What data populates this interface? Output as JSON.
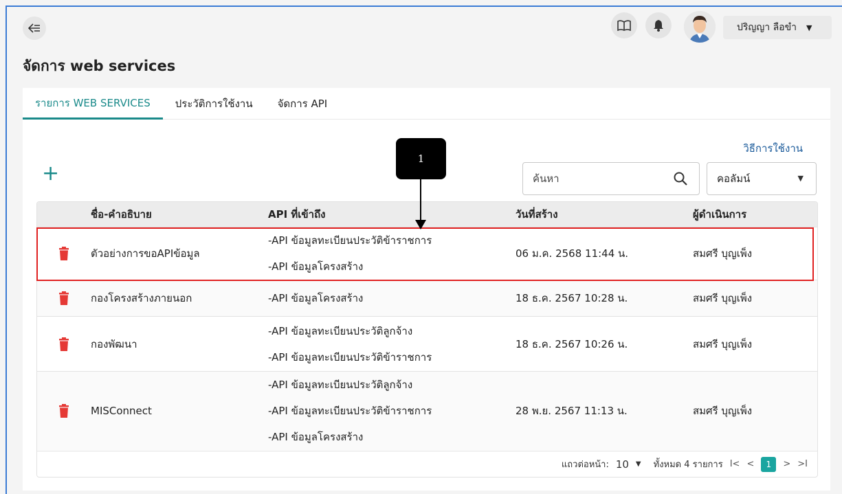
{
  "header": {
    "user_name": "ปริญญา ลือขำ"
  },
  "page": {
    "title": "จัดการ web services"
  },
  "tabs": [
    {
      "label": "รายการ WEB SERVICES"
    },
    {
      "label": "ประวัติการใช้งาน"
    },
    {
      "label": "จัดการ API"
    }
  ],
  "toolbar": {
    "help_link": "วิธีการใช้งาน",
    "add_symbol": "+",
    "search_placeholder": "ค้นหา",
    "column_select": "คอลัมน์"
  },
  "table": {
    "headers": {
      "name": "ชื่อ-คำอธิบาย",
      "api": "API ที่เข้าถึง",
      "created": "วันที่สร้าง",
      "operator": "ผู้ดำเนินการ"
    },
    "rows": [
      {
        "name": "ตัวอย่างการขอAPIข้อมูล",
        "apis": [
          "-API ข้อมูลทะเบียนประวัติข้าราชการ",
          "-API ข้อมูลโครงสร้าง"
        ],
        "created": "06 ม.ค. 2568 11:44 น.",
        "operator": "สมศรี บุญเพ็ง"
      },
      {
        "name": "กองโครงสร้างภายนอก",
        "apis": [
          "-API ข้อมูลโครงสร้าง"
        ],
        "created": "18 ธ.ค. 2567 10:28 น.",
        "operator": "สมศรี บุญเพ็ง"
      },
      {
        "name": "กองพัฒนา",
        "apis": [
          "-API ข้อมูลทะเบียนประวัติลูกจ้าง",
          "-API ข้อมูลทะเบียนประวัติข้าราชการ"
        ],
        "created": "18 ธ.ค. 2567 10:26 น.",
        "operator": "สมศรี บุญเพ็ง"
      },
      {
        "name": "MISConnect",
        "apis": [
          "-API ข้อมูลทะเบียนประวัติลูกจ้าง",
          "-API ข้อมูลทะเบียนประวัติข้าราชการ",
          "-API ข้อมูลโครงสร้าง"
        ],
        "created": "28 พ.ย. 2567 11:13 น.",
        "operator": "สมศรี บุญเพ็ง"
      }
    ]
  },
  "pagination": {
    "rows_per_page_label": "แถวต่อหน้า:",
    "rows_per_page": "10",
    "total_label": "ทั้งหมด 4 รายการ",
    "first": "I<",
    "prev": "<",
    "current_page": "1",
    "next": ">",
    "last": ">I"
  },
  "annotation": {
    "callout_number": "1"
  },
  "colors": {
    "accent": "#1a8a8a",
    "delete": "#e53935",
    "highlight": "#e02020"
  }
}
